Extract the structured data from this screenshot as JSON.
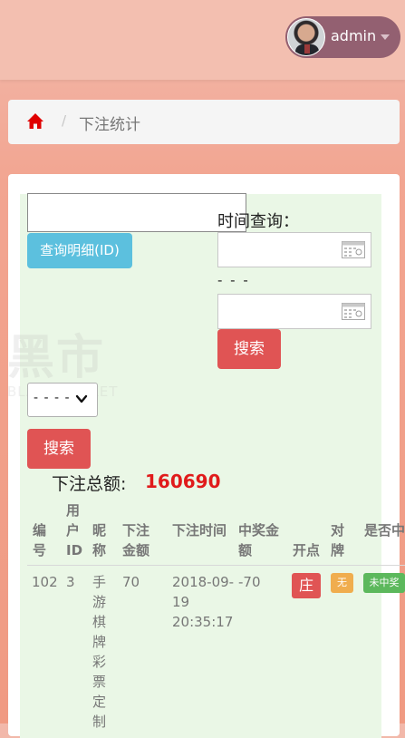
{
  "header": {
    "user_name": "admin"
  },
  "breadcrumb": {
    "current": "下注统计",
    "separator": "/"
  },
  "filters": {
    "detail_button": "查询明细(ID)",
    "time_label": "时间查询：",
    "range_separator": "- - -",
    "search_button": "搜索",
    "select_value": "- - - -"
  },
  "watermark": {
    "big": "黑市",
    "small": "BLACKMARKET"
  },
  "summary": {
    "label": "下注总额:",
    "value": "160690"
  },
  "table": {
    "headers": [
      "编号",
      "用户ID",
      "昵称",
      "下注金额",
      "下注时间",
      "中奖金额",
      "开点",
      "对牌",
      "是否中奖"
    ],
    "rows": [
      {
        "id": "102",
        "user_id": "3",
        "nickname": "手游棋牌彩票定制",
        "bet_amount": "70",
        "bet_time": "2018-09-19 20:35:17",
        "win_amount": "-70",
        "open_point": "庄",
        "pair": "无",
        "is_win": "未中奖"
      }
    ]
  },
  "colors": {
    "danger": "#e05454",
    "info": "#5cc0de",
    "warning": "#f0ad4e",
    "success": "#5cb85c",
    "total": "#e01b1b"
  }
}
